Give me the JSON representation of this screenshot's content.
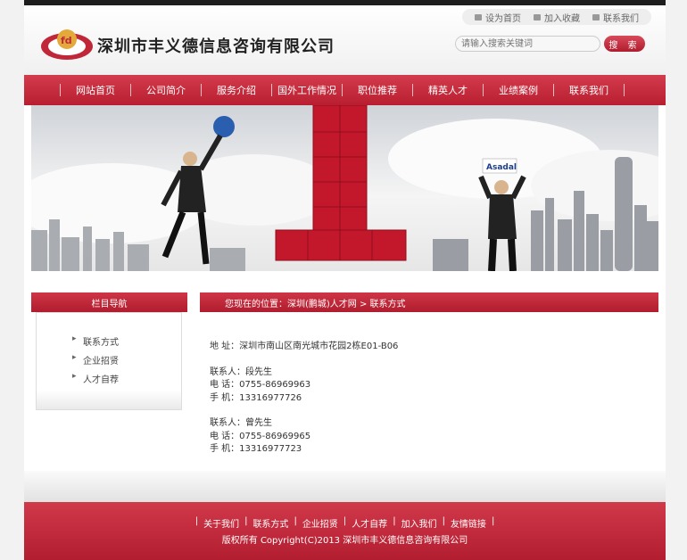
{
  "header": {
    "company_name": "深圳市丰义德信息咨询有限公司",
    "toplinks": [
      "设为首页",
      "加入收藏",
      "联系我们"
    ],
    "search_placeholder": "请输入搜索关键词",
    "search_button": "搜 索"
  },
  "nav": {
    "items": [
      "网站首页",
      "公司简介",
      "服务介绍",
      "国外工作情况",
      "职位推荐",
      "精英人才",
      "业绩案例",
      "联系我们"
    ]
  },
  "banner": {
    "sign_text": "Asadal"
  },
  "sidebar": {
    "title": "栏目导航",
    "items": [
      "联系方式",
      "企业招贤",
      "人才自荐"
    ]
  },
  "breadcrumb": {
    "text": "您现在的位置：深圳(鹏城)人才网 > 联系方式"
  },
  "contact": {
    "address": "地 址：深圳市南山区南光城市花园2栋E01-B06",
    "person1": "联系人：段先生",
    "phone1": "电 话：0755-86969963",
    "mobile1": "手 机：13316977726",
    "person2": "联系人：曾先生",
    "phone2": "电 话：0755-86969965",
    "mobile2": "手 机：13316977723"
  },
  "footer": {
    "links": [
      "关于我们",
      "联系方式",
      "企业招贤",
      "人才自荐",
      "加入我们",
      "友情链接"
    ],
    "copyright": "版权所有 Copyright(C)2013  深圳市丰义德信息咨询有限公司"
  },
  "colors": {
    "brand_red": "#c0283a",
    "dark_bar": "#1e1e1e"
  }
}
